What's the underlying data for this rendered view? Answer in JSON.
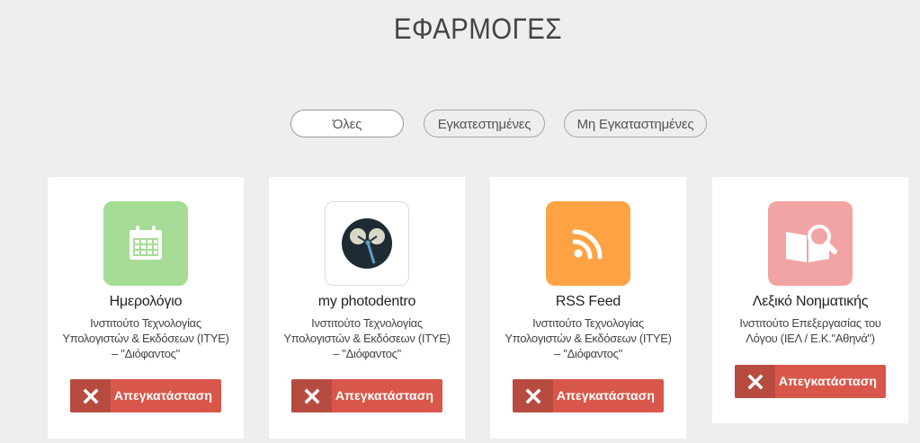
{
  "header": {
    "title": "ΕΦΑΡΜΟΓΕΣ"
  },
  "filters": [
    {
      "label": "Όλες",
      "active": true
    },
    {
      "label": "Εγκατεστημένες",
      "active": false
    },
    {
      "label": "Μη Εγκαταστημένες",
      "active": false
    }
  ],
  "apps": [
    {
      "name": "Ημερολόγιο",
      "publisher": "Ινστιτούτο Τεχνολογίας Υπολογιστών & Εκδόσεων (ΙΤΥΕ) – \"Διόφαντος\"",
      "icon": "calendar-icon",
      "icon_color": "#a6dc95",
      "action_label": "Απεγκατάσταση"
    },
    {
      "name": "my photodentro",
      "publisher": "Ινστιτούτο Τεχνολογίας Υπολογιστών & Εκδόσεων (ΙΤΥΕ) – \"Διόφαντος\"",
      "icon": "photodentro-icon",
      "icon_color": "#ffffff",
      "action_label": "Απεγκατάσταση"
    },
    {
      "name": "RSS Feed",
      "publisher": "Ινστιτούτο Τεχνολογίας Υπολογιστών & Εκδόσεων (ΙΤΥΕ) – \"Διόφαντος\"",
      "icon": "rss-icon",
      "icon_color": "#ffa244",
      "action_label": "Απεγκατάσταση"
    },
    {
      "name": "Λεξικό Νοηματικής",
      "publisher": "Ινστιτούτο Επεξεργασίας του Λόγου (ΙΕΛ / Ε.Κ.\"Αθηνά\")",
      "icon": "dictionary-search-icon",
      "icon_color": "#f2a3a3",
      "action_label": "Απεγκατάσταση"
    }
  ],
  "colors": {
    "background": "#eeeeee",
    "button_red": "#d9574a",
    "button_red_dark": "#b74b40"
  }
}
